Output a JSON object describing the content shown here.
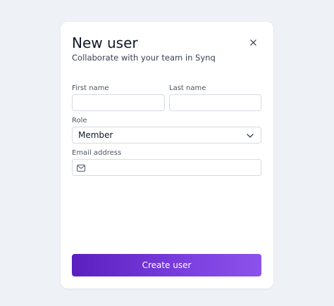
{
  "modal": {
    "title": "New user",
    "subtitle": "Collaborate with your team in Synq",
    "close_icon": "close-icon"
  },
  "form": {
    "first_name": {
      "label": "First name",
      "value": ""
    },
    "last_name": {
      "label": "Last name",
      "value": ""
    },
    "role": {
      "label": "Role",
      "value": "Member",
      "icon": "chevron-down-icon"
    },
    "email": {
      "label": "Email address",
      "value": "",
      "icon": "mail-icon"
    }
  },
  "submit": {
    "label": "Create user"
  },
  "colors": {
    "background": "#eef1f5",
    "accent_start": "#5b1fc0",
    "accent_end": "#8d52ea"
  }
}
